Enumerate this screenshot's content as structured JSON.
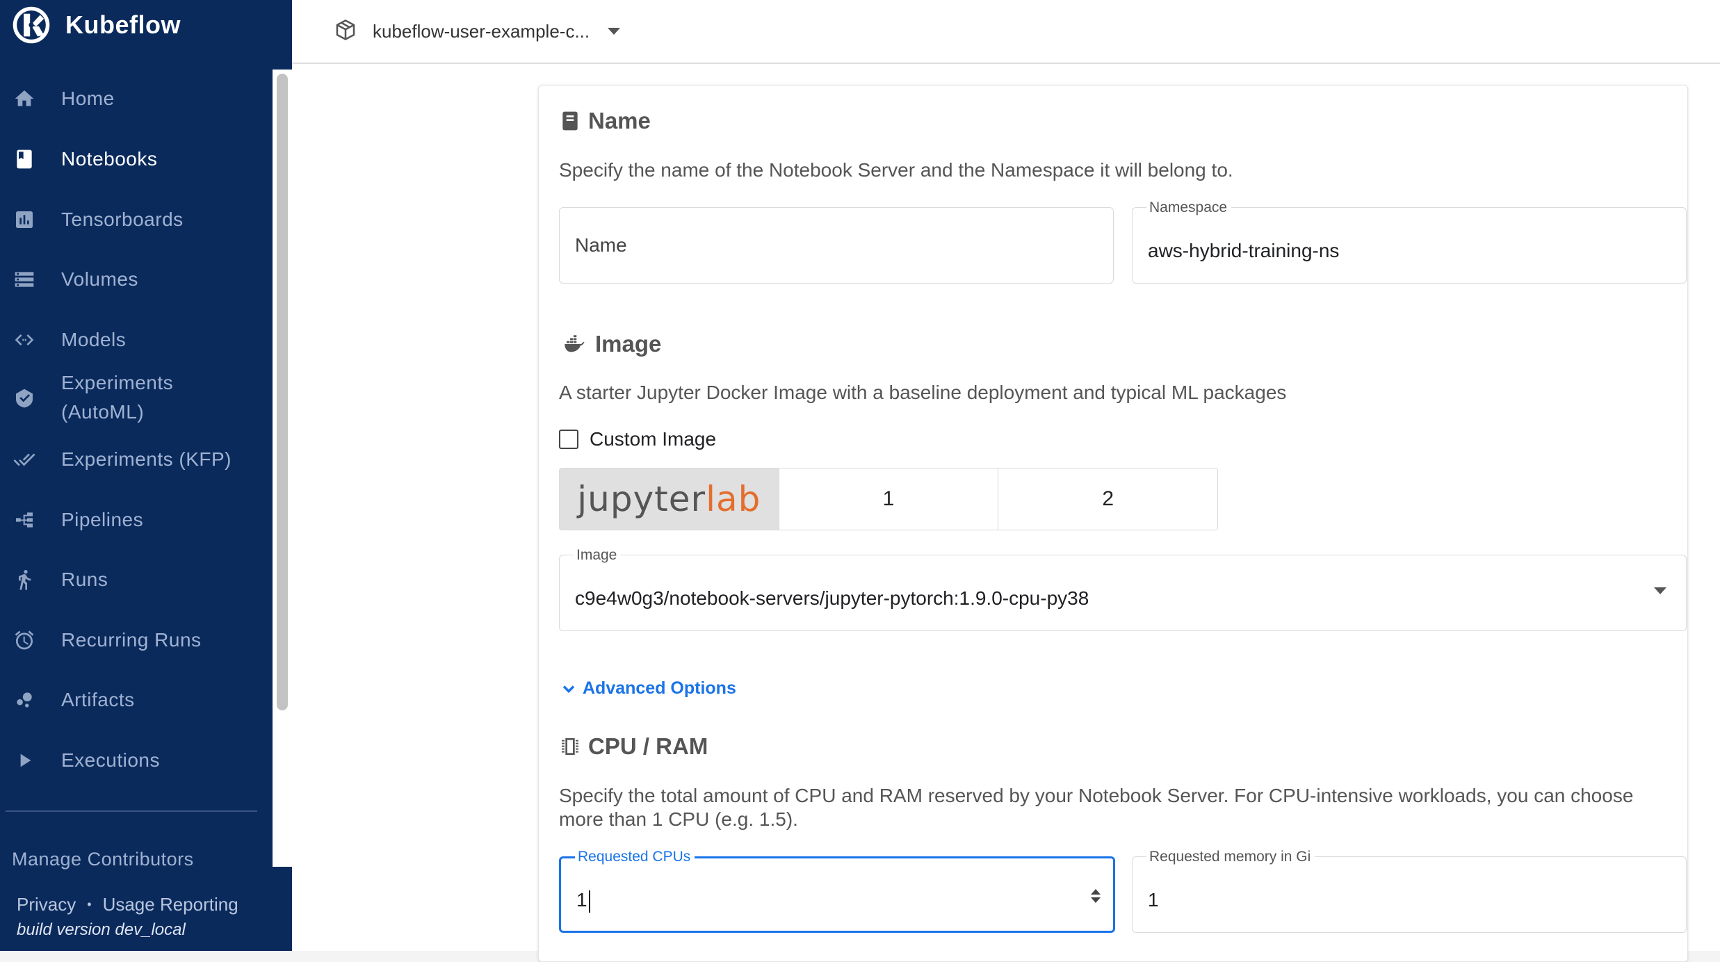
{
  "brand": {
    "name": "Kubeflow",
    "logo_icon": "kubeflow-logo-icon"
  },
  "colors": {
    "sidebar_bg": "#0b2a5c",
    "accent": "#1a73e8",
    "jupyter_orange": "#e46e2e"
  },
  "topbar": {
    "namespace_selector": "kubeflow-user-example-c..."
  },
  "nav": {
    "items": [
      {
        "label": "Home",
        "icon": "home-icon",
        "active": false
      },
      {
        "label": "Notebooks",
        "icon": "book-icon",
        "active": true
      },
      {
        "label": "Tensorboards",
        "icon": "chart-icon",
        "active": false
      },
      {
        "label": "Volumes",
        "icon": "storage-icon",
        "active": false
      },
      {
        "label": "Models",
        "icon": "code-arrows-icon",
        "active": false
      },
      {
        "label": "Experiments\n(AutoML)",
        "icon": "tag-icon",
        "active": false
      },
      {
        "label": "Experiments (KFP)",
        "icon": "done-all-icon",
        "active": false
      },
      {
        "label": "Pipelines",
        "icon": "pipeline-icon",
        "active": false
      },
      {
        "label": "Runs",
        "icon": "run-icon",
        "active": false
      },
      {
        "label": "Recurring Runs",
        "icon": "alarm-icon",
        "active": false
      },
      {
        "label": "Artifacts",
        "icon": "bubble-chart-icon",
        "active": false
      },
      {
        "label": "Executions",
        "icon": "play-icon",
        "active": false
      }
    ],
    "manage_contributors": "Manage Contributors",
    "footer": {
      "privacy": "Privacy",
      "separator": "•",
      "usage": "Usage Reporting",
      "build": "build version dev_local"
    }
  },
  "form": {
    "name_section": {
      "title": "Name",
      "description": "Specify the name of the Notebook Server and the Namespace it will belong to.",
      "name_placeholder": "Name",
      "namespace_label": "Namespace",
      "namespace_value": "aws-hybrid-training-ns"
    },
    "image_section": {
      "title": "Image",
      "description": "A starter Jupyter Docker Image with a baseline deployment and typical ML packages",
      "custom_image_label": "Custom Image",
      "custom_image_checked": false,
      "toggle": {
        "logo_part1": "jupyter",
        "logo_part2": "lab",
        "option_1": "1",
        "option_2": "2"
      },
      "image_label": "Image",
      "image_value": "c9e4w0g3/notebook-servers/jupyter-pytorch:1.9.0-cpu-py38"
    },
    "advanced_options": "Advanced Options",
    "cpu_section": {
      "title": "CPU / RAM",
      "description": "Specify the total amount of CPU and RAM reserved by your Notebook Server. For CPU-intensive workloads, you can choose more than 1 CPU (e.g. 1.5).",
      "cpu_label": "Requested CPUs",
      "cpu_value": "1",
      "memory_label": "Requested memory in Gi",
      "memory_value": "1"
    }
  }
}
